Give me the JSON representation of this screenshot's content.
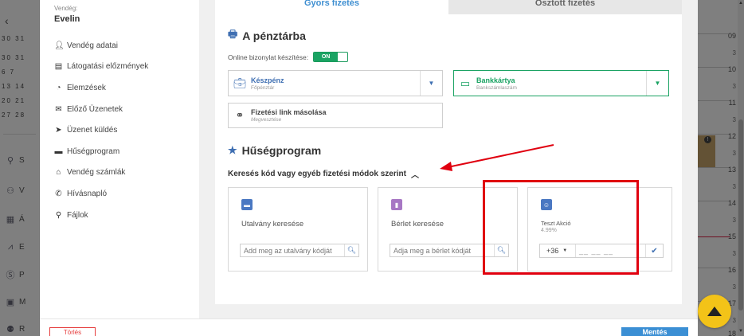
{
  "background": {
    "calendar_rows": [
      "31",
      "6 7",
      "13 14",
      "20 21",
      "27 28"
    ],
    "calendar_dim_row": "30 31",
    "nav_items": [
      {
        "glyph": "S",
        "icon": "person-icon"
      },
      {
        "glyph": "V",
        "icon": "group-icon"
      },
      {
        "glyph": "Á",
        "icon": "grid-icon"
      },
      {
        "glyph": "E",
        "icon": "chart-icon"
      },
      {
        "glyph": "P",
        "icon": "coin-icon"
      },
      {
        "glyph": "M",
        "icon": "box-icon"
      },
      {
        "glyph": "R",
        "icon": "team-icon"
      }
    ],
    "hours": [
      "09",
      "10",
      "11",
      "12",
      "13",
      "14",
      "15",
      "16",
      "17",
      "18"
    ],
    "half_mark": "3"
  },
  "sidebar": {
    "guest_label": "Vendég:",
    "guest_name": "Evelin",
    "items": [
      {
        "label": "Vendég adatai",
        "icon": "user-icon"
      },
      {
        "label": "Látogatási előzmények",
        "icon": "list-icon"
      },
      {
        "label": "Elemzések",
        "icon": "pie-chart-icon"
      },
      {
        "label": "Előző Üzenetek",
        "icon": "envelope-icon"
      },
      {
        "label": "Üzenet küldés",
        "icon": "send-icon"
      },
      {
        "label": "Hűségprogram",
        "icon": "card-icon"
      },
      {
        "label": "Vendég számlák",
        "icon": "bank-icon"
      },
      {
        "label": "Hívásnapló",
        "icon": "phone-icon"
      },
      {
        "label": "Fájlok",
        "icon": "paperclip-icon"
      }
    ]
  },
  "tabs": {
    "quick_payment": "Gyors fizetés",
    "split_payment": "Osztott fizetés"
  },
  "register": {
    "title": "A pénztárba",
    "online_label": "Online bizonylat készítése:",
    "toggle_label": "ON",
    "cash": {
      "title": "Készpénz",
      "subtitle": "Főpénztár"
    },
    "card": {
      "title": "Bankkártya",
      "subtitle": "Bankszámlaszám"
    },
    "link": {
      "title": "Fizetési link másolása",
      "subtitle": "Megvesztése"
    }
  },
  "loyalty": {
    "title": "Hűségprogram",
    "search_toggle": "Keresés kód vagy egyéb fizetési módok szerint",
    "voucher": {
      "title": "Utalvány keresése",
      "placeholder": "Add meg az utalvány kódját"
    },
    "pass": {
      "title": "Bérlet keresése",
      "placeholder": "Adja meg a bérlet kódját"
    },
    "promo": {
      "title": "Teszt Akció",
      "percent": "4.99%",
      "country_code": "+36",
      "phone_mask": "__ __ __"
    }
  },
  "footer": {
    "delete_label": "Törlés",
    "save_label": "Mentés"
  },
  "colors": {
    "accent_blue": "#3f8fd1",
    "toggle_green": "#1aa363",
    "highlight_red": "#e0000f",
    "fab_yellow": "#f3c318"
  }
}
